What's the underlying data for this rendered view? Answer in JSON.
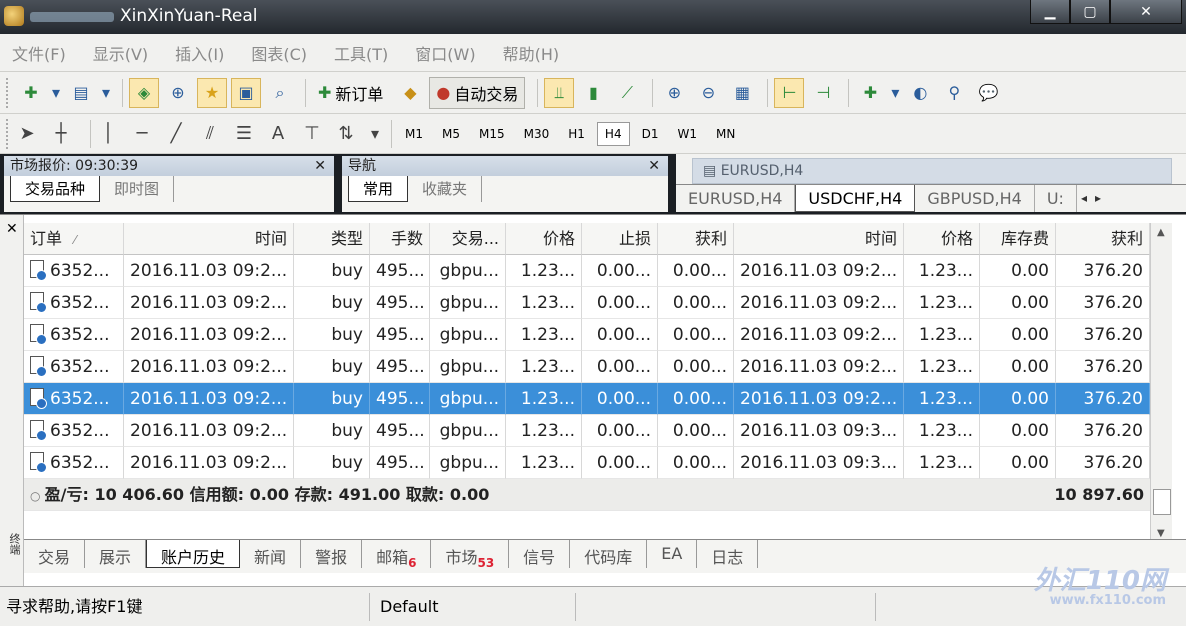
{
  "window": {
    "title": "XinXinYuan-Real",
    "min": "▁",
    "max": "▢",
    "close": "✕"
  },
  "menu": [
    "文件(F)",
    "显示(V)",
    "插入(I)",
    "图表(C)",
    "工具(T)",
    "窗口(W)",
    "帮助(H)"
  ],
  "toolbar": {
    "new_order": "新订单",
    "auto_trade": "自动交易"
  },
  "timeframes": [
    "M1",
    "M5",
    "M15",
    "M30",
    "H1",
    "H4",
    "D1",
    "W1",
    "MN"
  ],
  "timeframe_selected": "H4",
  "drawing_tools": {
    "text_tool": "A"
  },
  "market_watch": {
    "header": "市场报价: 09:30:39",
    "tabs": [
      "交易品种",
      "即时图"
    ]
  },
  "navigator": {
    "header": "导航",
    "tabs": [
      "常用",
      "收藏夹"
    ]
  },
  "chart": {
    "ghost_title": "EURUSD,H4",
    "tabs": [
      "EURUSD,H4",
      "USDCHF,H4",
      "GBPUSD,H4",
      "U:"
    ]
  },
  "terminal": {
    "columns": [
      "订单",
      "时间",
      "类型",
      "手数",
      "交易...",
      "价格",
      "止损",
      "获利",
      "时间",
      "价格",
      "库存费",
      "获利"
    ],
    "sort_indicator": "⁄",
    "rows": [
      [
        "6352...",
        "2016.11.03 09:2...",
        "buy",
        "495...",
        "gbpu...",
        "1.23...",
        "0.00...",
        "0.00...",
        "2016.11.03 09:2...",
        "1.23...",
        "0.00",
        "376.20"
      ],
      [
        "6352...",
        "2016.11.03 09:2...",
        "buy",
        "495...",
        "gbpu...",
        "1.23...",
        "0.00...",
        "0.00...",
        "2016.11.03 09:2...",
        "1.23...",
        "0.00",
        "376.20"
      ],
      [
        "6352...",
        "2016.11.03 09:2...",
        "buy",
        "495...",
        "gbpu...",
        "1.23...",
        "0.00...",
        "0.00...",
        "2016.11.03 09:2...",
        "1.23...",
        "0.00",
        "376.20"
      ],
      [
        "6352...",
        "2016.11.03 09:2...",
        "buy",
        "495...",
        "gbpu...",
        "1.23...",
        "0.00...",
        "0.00...",
        "2016.11.03 09:2...",
        "1.23...",
        "0.00",
        "376.20"
      ],
      [
        "6352...",
        "2016.11.03 09:2...",
        "buy",
        "495...",
        "gbpu...",
        "1.23...",
        "0.00...",
        "0.00...",
        "2016.11.03 09:2...",
        "1.23...",
        "0.00",
        "376.20"
      ],
      [
        "6352...",
        "2016.11.03 09:2...",
        "buy",
        "495...",
        "gbpu...",
        "1.23...",
        "0.00...",
        "0.00...",
        "2016.11.03 09:3...",
        "1.23...",
        "0.00",
        "376.20"
      ],
      [
        "6352...",
        "2016.11.03 09:2...",
        "buy",
        "495...",
        "gbpu...",
        "1.23...",
        "0.00...",
        "0.00...",
        "2016.11.03 09:3...",
        "1.23...",
        "0.00",
        "376.20"
      ]
    ],
    "selected_row": 4,
    "summary": "盈/亏: 10 406.60  信用额: 0.00  存款: 491.00  取款: 0.00",
    "summary_total": "10 897.60",
    "side_label": "终端",
    "tabs": [
      "交易",
      "展示",
      "账户历史",
      "新闻",
      "警报",
      "邮箱",
      "市场",
      "信号",
      "代码库",
      "EA",
      "日志"
    ],
    "active_tab": "账户历史",
    "mail_count": "6",
    "market_count": "53"
  },
  "status": {
    "help": "寻求帮助,请按F1键",
    "profile": "Default"
  },
  "watermark": {
    "brand": "外汇110网",
    "url": "www.fx110.com"
  },
  "colors": {
    "selection": "#3b8fd9",
    "title_bg": "#23282e"
  }
}
